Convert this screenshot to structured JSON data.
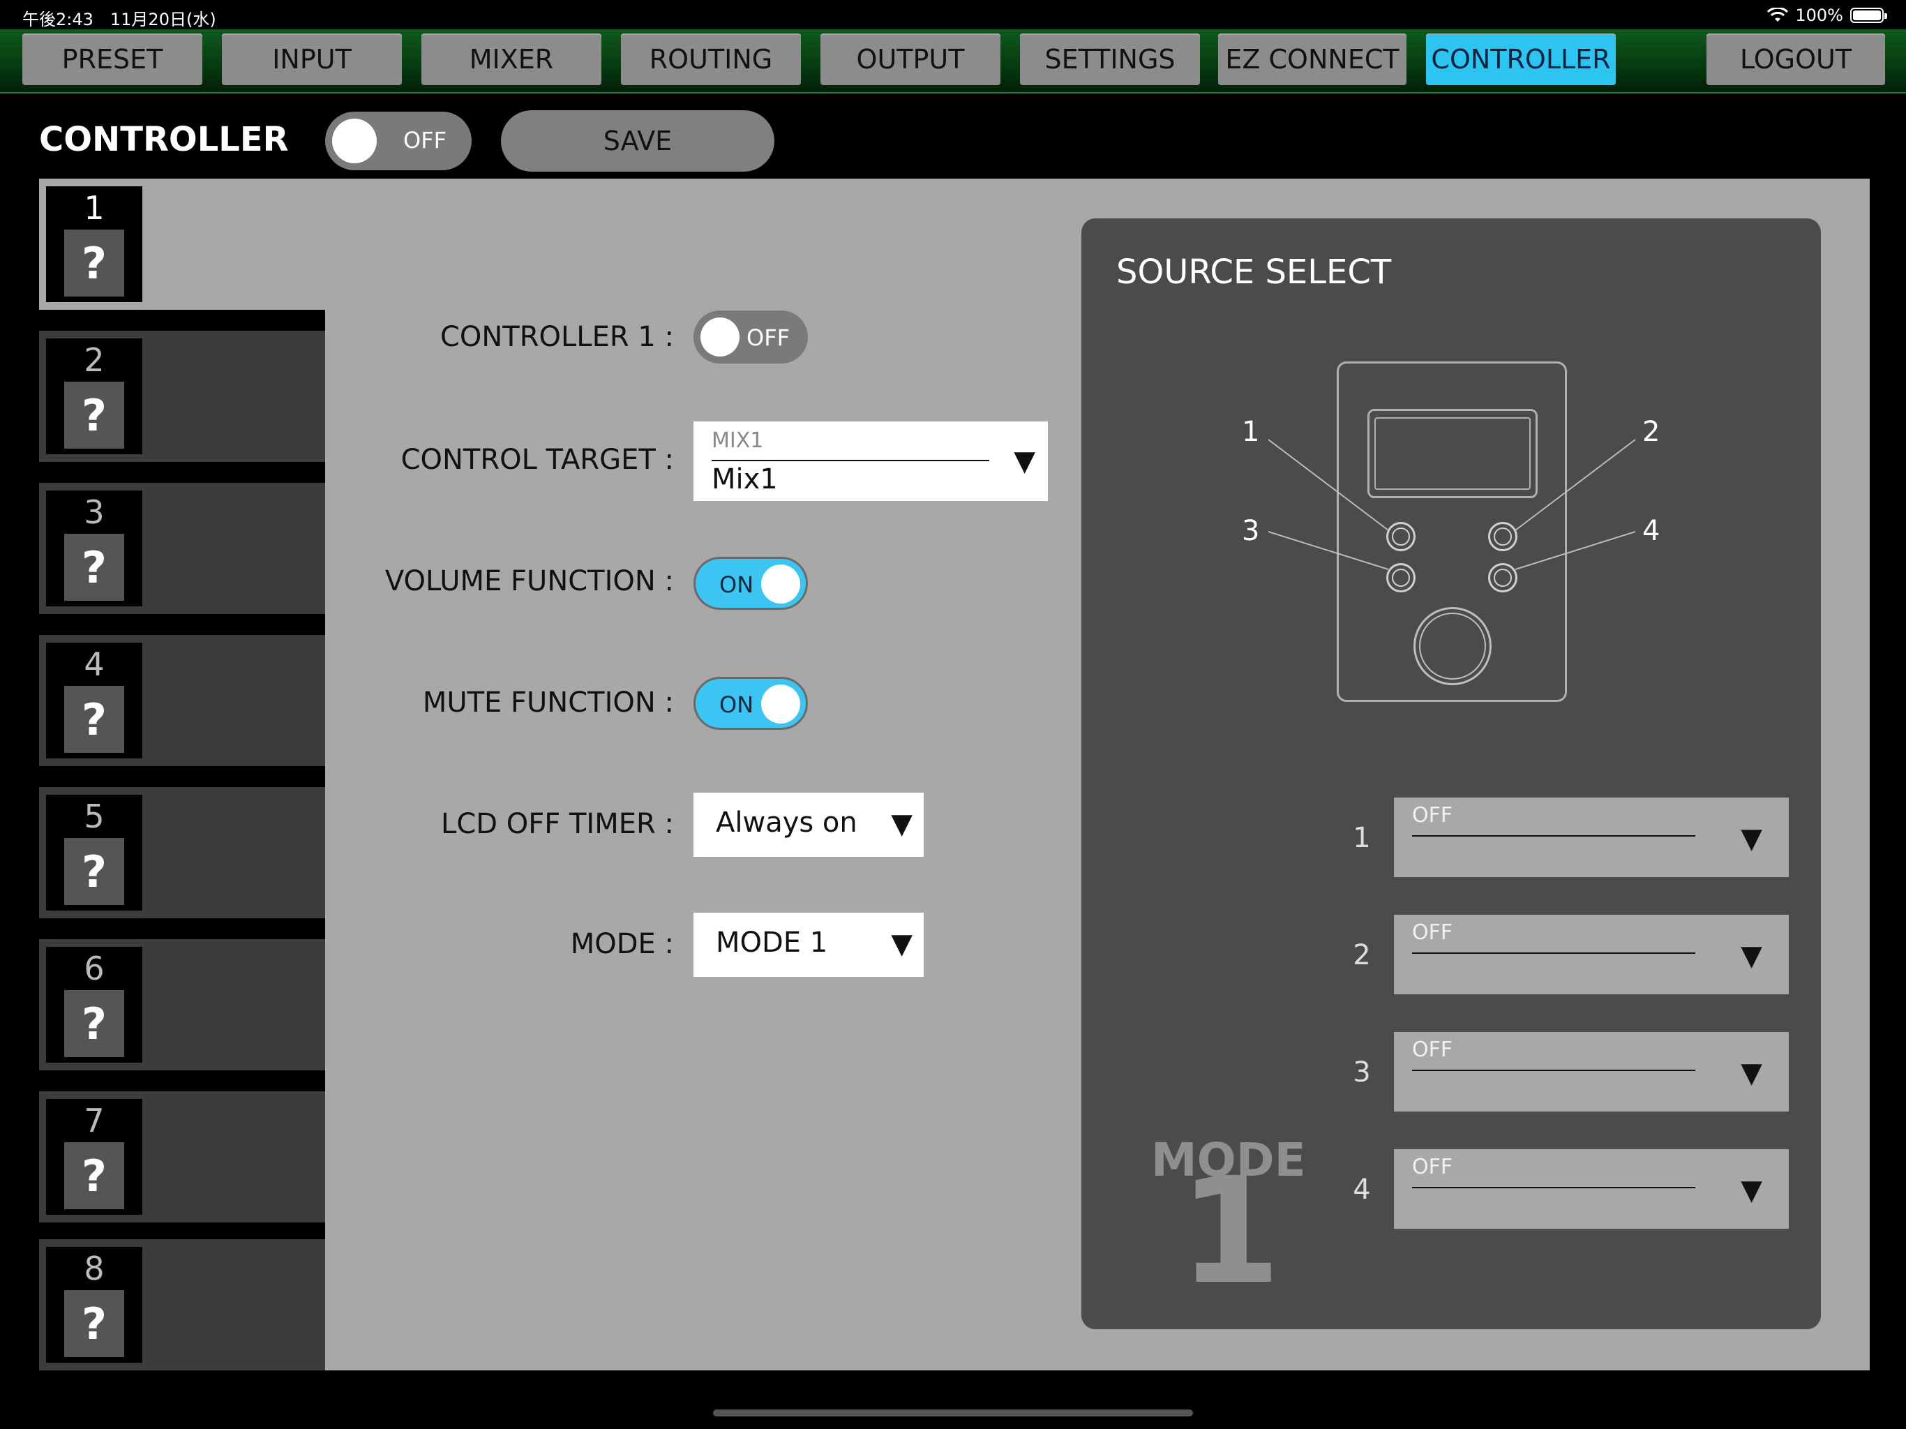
{
  "status_bar": {
    "time": "午後2:43　11月20日(水)",
    "battery": "100%"
  },
  "nav": {
    "tabs": [
      {
        "label": "PRESET"
      },
      {
        "label": "INPUT"
      },
      {
        "label": "MIXER"
      },
      {
        "label": "ROUTING"
      },
      {
        "label": "OUTPUT"
      },
      {
        "label": "SETTINGS"
      },
      {
        "label": "EZ CONNECT"
      },
      {
        "label": "CONTROLLER"
      }
    ],
    "logout": "LOGOUT",
    "active_tab": "CONTROLLER"
  },
  "header": {
    "title": "CONTROLLER",
    "master_toggle": "OFF",
    "save_label": "SAVE"
  },
  "controllers": [
    {
      "num": "1",
      "icon": "?"
    },
    {
      "num": "2",
      "icon": "?"
    },
    {
      "num": "3",
      "icon": "?"
    },
    {
      "num": "4",
      "icon": "?"
    },
    {
      "num": "5",
      "icon": "?"
    },
    {
      "num": "6",
      "icon": "?"
    },
    {
      "num": "7",
      "icon": "?"
    },
    {
      "num": "8",
      "icon": "?"
    }
  ],
  "form": {
    "controller_label": "CONTROLLER 1 :",
    "controller_state": "OFF",
    "target_label": "CONTROL TARGET :",
    "target_small": "MIX1",
    "target_value": "Mix1",
    "volume_label": "VOLUME FUNCTION :",
    "volume_state": "ON",
    "mute_label": "MUTE FUNCTION :",
    "mute_state": "ON",
    "lcd_label": "LCD OFF TIMER :",
    "lcd_value": "Always on",
    "mode_label": "MODE :",
    "mode_value": "MODE 1"
  },
  "source_select": {
    "title": "SOURCE SELECT",
    "callouts": [
      "1",
      "2",
      "3",
      "4"
    ],
    "rows": [
      {
        "num": "1",
        "value": "OFF"
      },
      {
        "num": "2",
        "value": "OFF"
      },
      {
        "num": "3",
        "value": "OFF"
      },
      {
        "num": "4",
        "value": "OFF"
      }
    ],
    "mode_word": "MODE",
    "mode_number": "1"
  },
  "glyphs": {
    "caret": "▼"
  },
  "colors": {
    "accent": "#2ec4f2",
    "nav_green": "#0e5a1e",
    "panel": "#a8a8a8",
    "dark_panel": "#4b4b4b"
  }
}
